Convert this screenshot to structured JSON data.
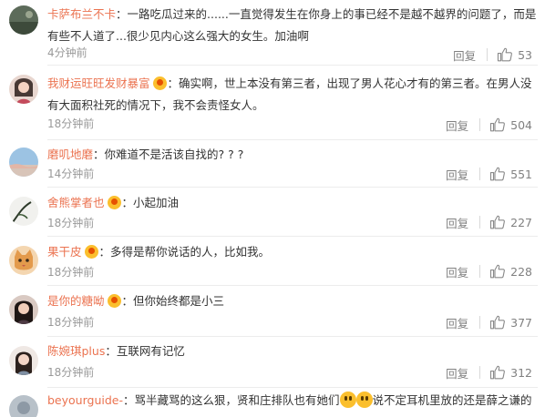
{
  "reply_label": "回复",
  "colors": {
    "username": "#eb7350",
    "meta": "#999999",
    "vip_badge": "#fbbf2d"
  },
  "comments": [
    {
      "username": "卡萨布兰不卡",
      "text_line1": "一路吃瓜过来的......一直觉得发生在你身上的事已经不是越不越界的问题了，而是",
      "text_line2": "有些不人道了...很少见内心这么强大的女生。加油啊",
      "time": "4分钟前",
      "likes": "53"
    },
    {
      "username": "我财运旺旺发财暴富",
      "text_line1": "确实啊，世上本没有第三者，出现了男人花心才有的第三者。在男人没",
      "text_line2": "有大面积社死的情况下，我不会责怪女人。",
      "time": "18分钟前",
      "likes": "504"
    },
    {
      "username": "磨叽地磨",
      "text_line1": "你难道不是活该自找的? ? ?",
      "time": "14分钟前",
      "likes": "551"
    },
    {
      "username": "舍熊掌者也",
      "text_line1": "小起加油",
      "time": "18分钟前",
      "likes": "227"
    },
    {
      "username": "果干皮",
      "text_line1": "多得是帮你说话的人，比如我。",
      "time": "18分钟前",
      "likes": "228"
    },
    {
      "username": "是你的糖呦",
      "text_line1": "但你始终都是小三",
      "time": "18分钟前",
      "likes": "377"
    },
    {
      "username": "陈婉琪plus",
      "text_line1": "互联网有记忆",
      "time": "18分钟前",
      "likes": "312"
    },
    {
      "username": "beyourguide-",
      "text_before_emoji": "骂半藏骂的这么狠，贤和庄排队也有她们",
      "text_after_emoji": "说不定耳机里放的还是薛之谦的"
    }
  ]
}
